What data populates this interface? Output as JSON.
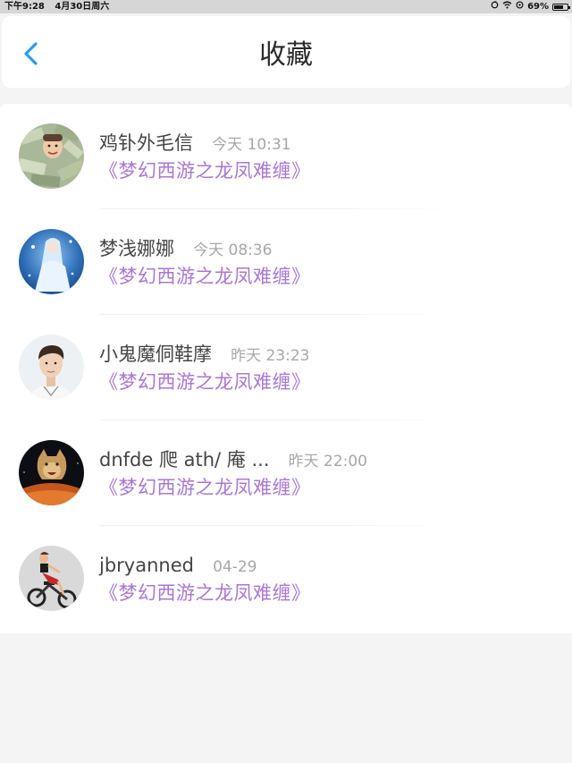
{
  "status_bar": {
    "time": "下午9:28",
    "date": "4月30日周六",
    "battery": "69%",
    "battery_level": 0.69
  },
  "header": {
    "title": "收藏"
  },
  "favorites": [
    {
      "name": "鸡钋外毛信",
      "time": "今天 10:31",
      "title": "《梦幻西游之龙凤难缠》"
    },
    {
      "name": "梦浅娜娜",
      "time": "今天 08:36",
      "title": "《梦幻西游之龙凤难缠》"
    },
    {
      "name": "小鬼魔侗鞋摩",
      "time": "昨天 23:23",
      "title": "《梦幻西游之龙凤难缠》"
    },
    {
      "name": "dnfde 爬 ath/ 庵 ...",
      "time": "昨天 22:00",
      "title": "《梦幻西游之龙凤难缠》"
    },
    {
      "name": "jbryanned",
      "time": "04-29",
      "title": "《梦幻西游之龙凤难缠》"
    }
  ],
  "colors": {
    "accent": "#2b9cf0",
    "game_title": "#a877d3",
    "timestamp": "#a7a7a7"
  }
}
